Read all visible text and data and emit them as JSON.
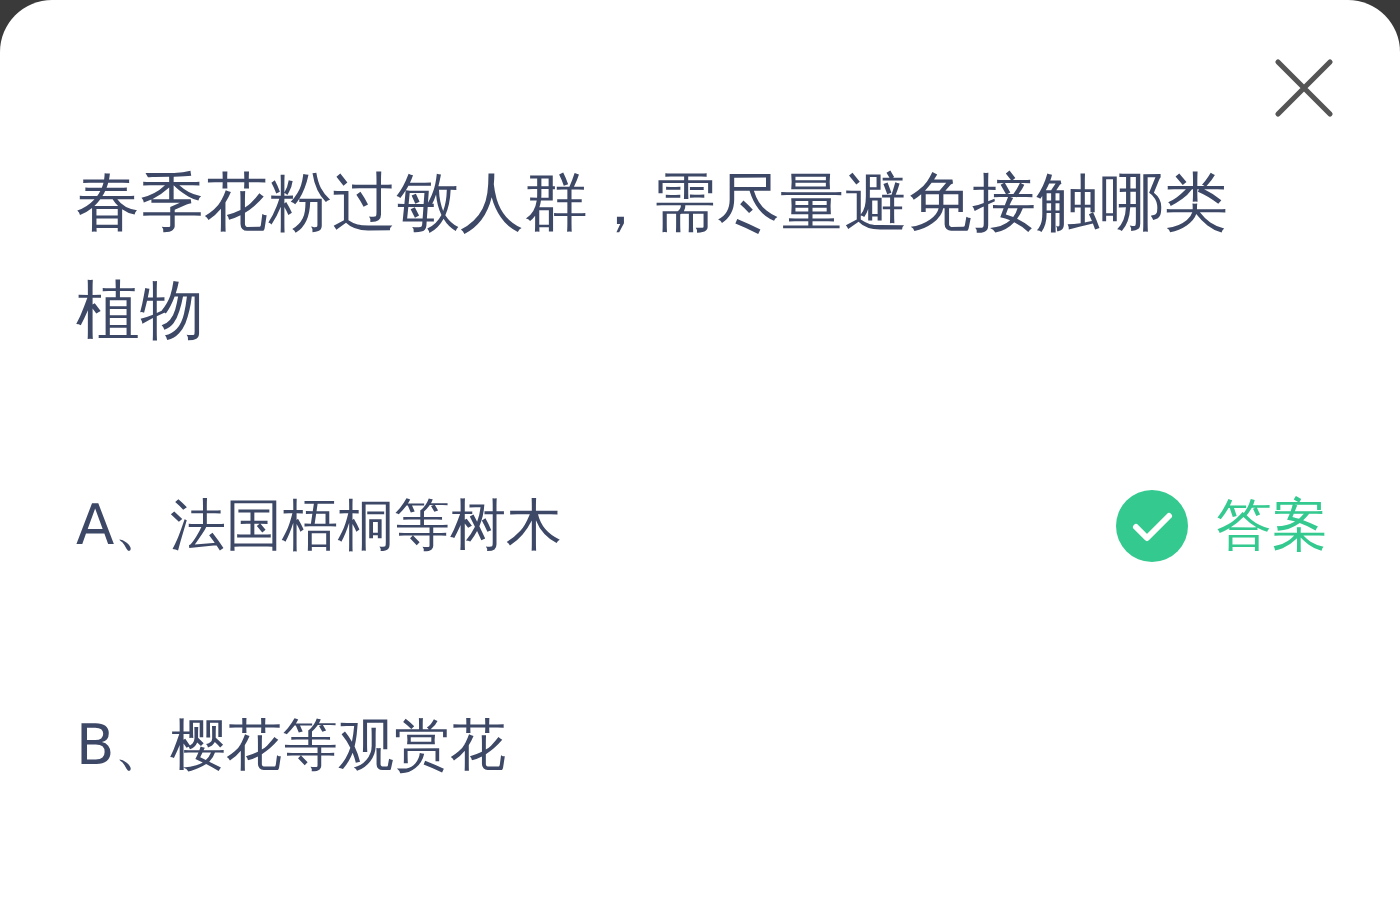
{
  "question": "春季花粉过敏人群，需尽量避免接触哪类植物",
  "options": [
    {
      "label": "A、法国梧桐等树木",
      "correct": true,
      "answer_label": "答案"
    },
    {
      "label": "B、樱花等观赏花",
      "correct": false
    }
  ]
}
